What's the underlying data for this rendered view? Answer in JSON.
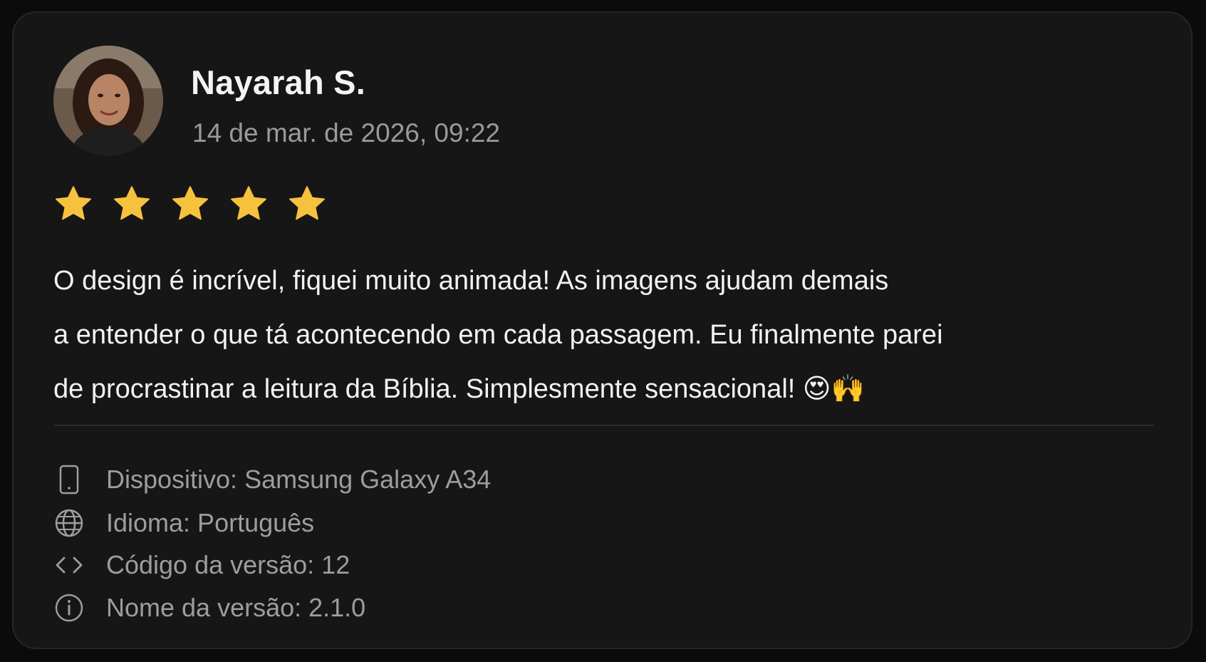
{
  "review": {
    "author": "Nayarah S.",
    "date": "14 de mar. de 2026, 09:22",
    "rating": 5,
    "rating_max": 5,
    "text_lines": [
      "O design é incrível, fiquei muito animada! As imagens ajudam demais",
      "a entender o que tá acontecendo em cada passagem. Eu finalmente parei",
      "de procrastinar a leitura da Bíblia. Simplesmente sensacional! 😍🙌"
    ]
  },
  "meta": [
    {
      "icon": "smartphone-icon",
      "text": "Dispositivo: Samsung Galaxy A34"
    },
    {
      "icon": "globe-icon",
      "text": "Idioma: Português"
    },
    {
      "icon": "code-icon",
      "text": "Código da versão: 12"
    },
    {
      "icon": "info-icon",
      "text": "Nome da versão: 2.1.0"
    }
  ],
  "colors": {
    "star": "#f6c23e",
    "background": "#161616",
    "text": "#f2f2f2",
    "muted": "#9d9d9d"
  }
}
